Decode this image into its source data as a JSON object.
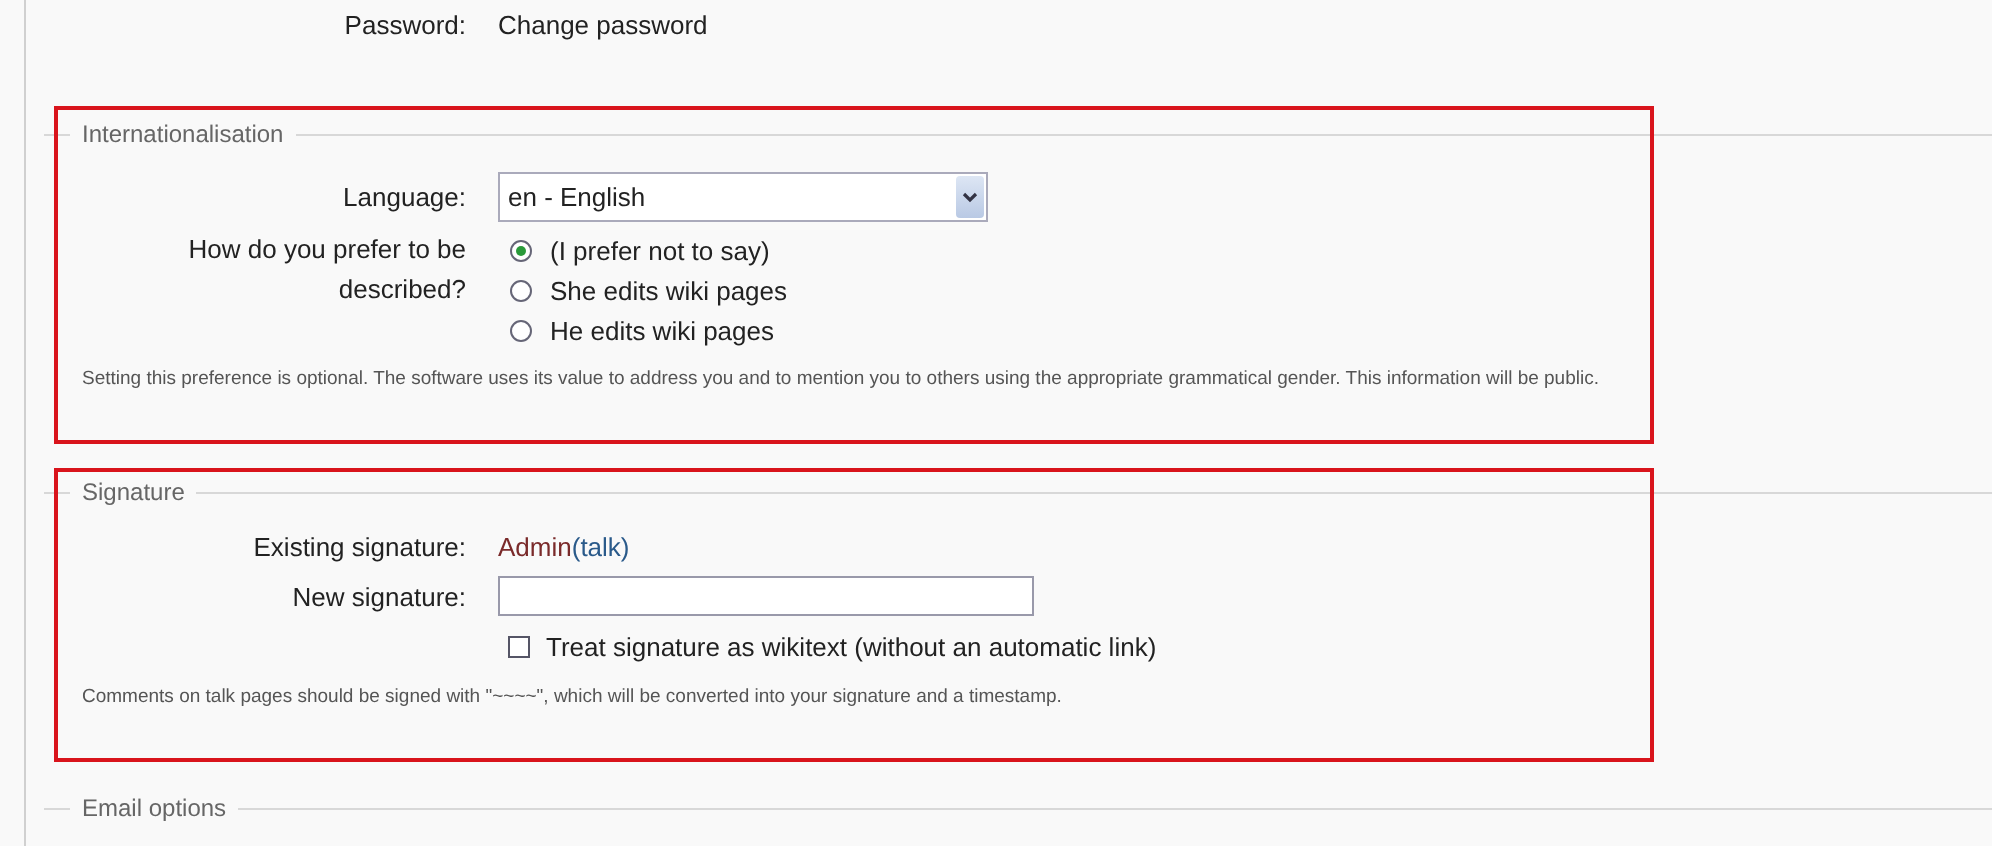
{
  "password": {
    "label": "Password:",
    "link": "Change password"
  },
  "sections": [
    {
      "kind": "internationalisation",
      "legend": "Internationalisation",
      "highlighted": true,
      "language": {
        "label": "Language:",
        "value": "en - English"
      },
      "gender": {
        "label": "How do you prefer to be described?",
        "options": [
          {
            "label": "(I prefer not to say)",
            "selected": true
          },
          {
            "label": "She edits wiki pages",
            "selected": false
          },
          {
            "label": "He edits wiki pages",
            "selected": false
          }
        ]
      },
      "help": "Setting this preference is optional. The software uses its value to address you and to mention you to others using the appropriate grammatical gender. This information will be public."
    },
    {
      "kind": "signature",
      "legend": "Signature",
      "highlighted": true,
      "existing": {
        "label": "Existing signature:",
        "user": "Admin",
        "talk": "(talk)"
      },
      "new_signature": {
        "label": "New signature:"
      },
      "wikitext": {
        "label": "Treat signature as wikitext (without an automatic link)",
        "checked": false
      },
      "help": "Comments on talk pages should be signed with \"~~~~\", which will be converted into your signature and a timestamp."
    },
    {
      "kind": "email",
      "legend": "Email options",
      "highlighted": false
    }
  ]
}
